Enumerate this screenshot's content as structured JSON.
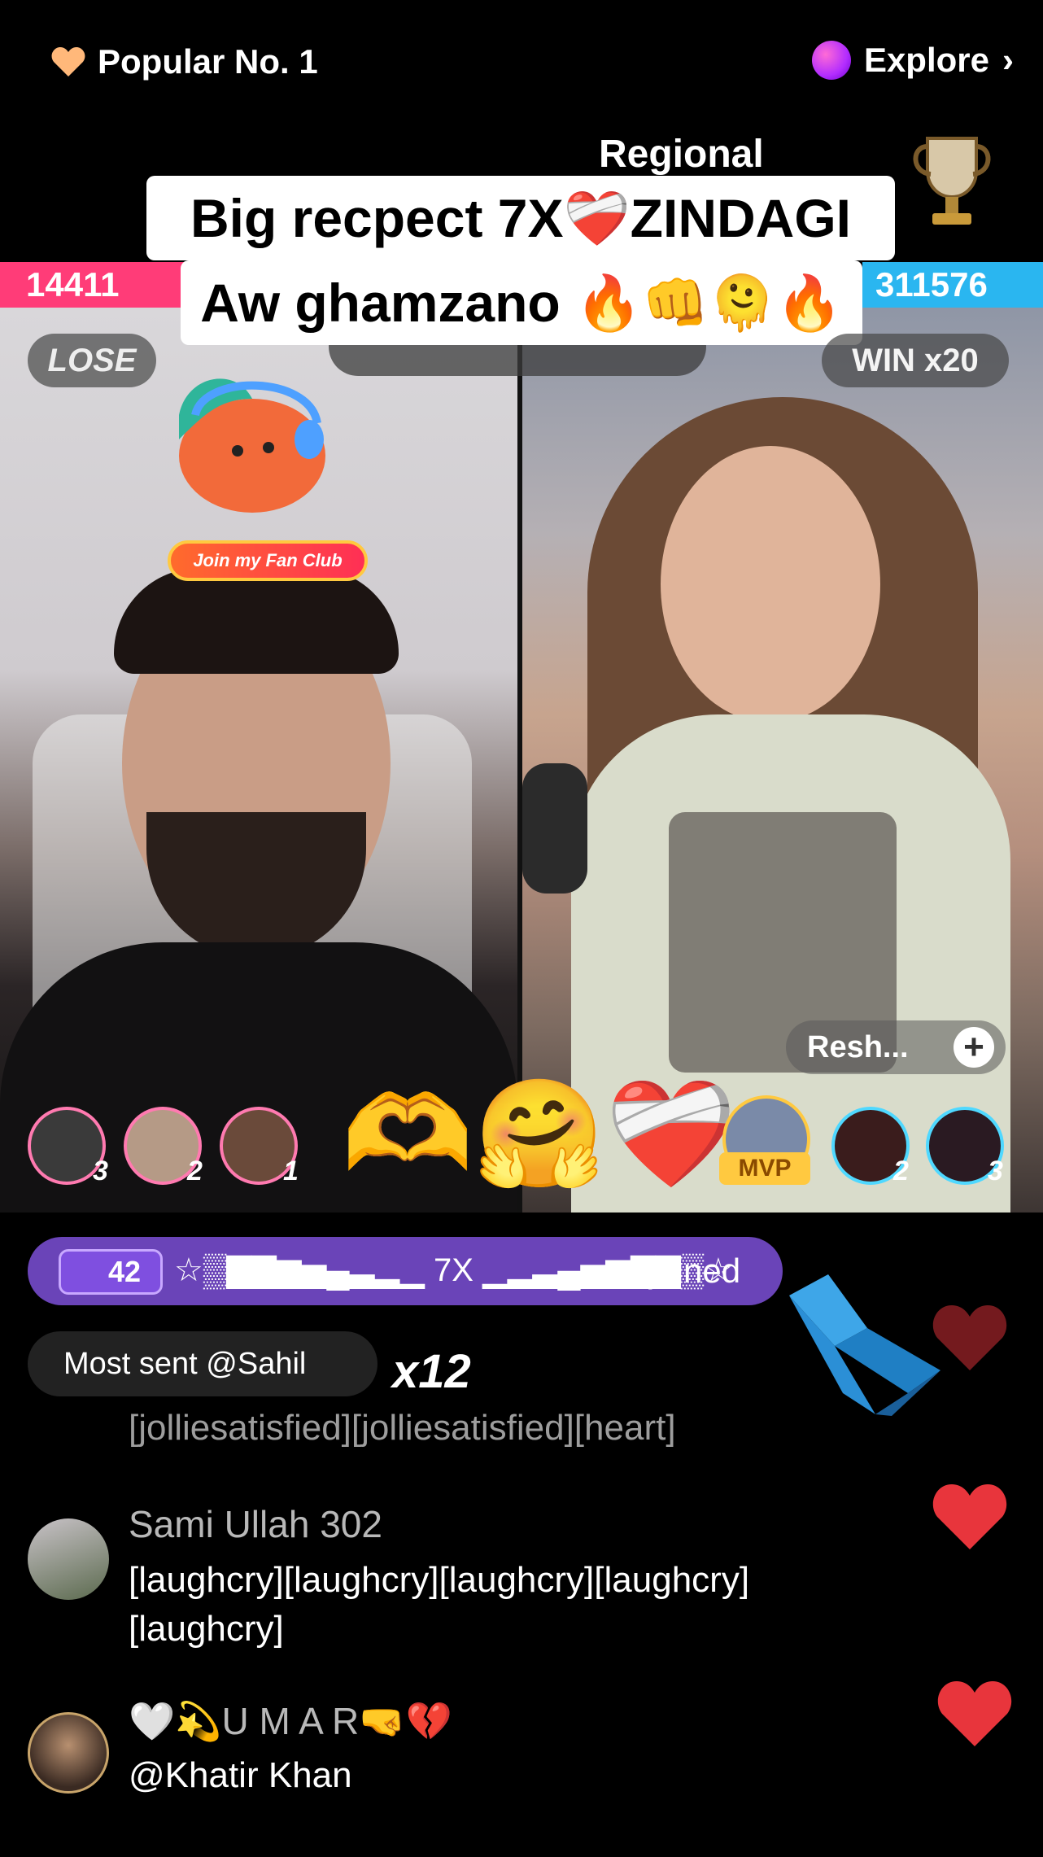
{
  "top": {
    "popular_label": "Popular No. 1",
    "explore_label": "Explore"
  },
  "regional_label": "Regional",
  "caption": {
    "line1": "Big recpect 7X❤️‍🩹ZINDAGI",
    "line2": "Aw ghamzano 🔥👊🫠🔥"
  },
  "battle": {
    "left_score": "14411",
    "right_score": "311576",
    "left_status": "LOSE",
    "right_status": "WIN x20",
    "fan_club_label": "Join my Fan Club",
    "right_guest_label": "Resh...",
    "left_gifter_ranks": [
      "3",
      "2",
      "1"
    ],
    "right_gifter_ranks": [
      "2",
      "3"
    ],
    "mvp_label": "MVP",
    "center_emojis": "🫶🤗❤️‍🩹"
  },
  "join_bar": {
    "level": "42",
    "name_text": "☆▒▇▇▆▅▄▃▂▁ 7X ▁▂▃▄▅▆▇▇▒☆",
    "joined_label": "joined"
  },
  "most_sent": {
    "label": "Most sent @Sahil",
    "multiplier": "x12"
  },
  "comments": [
    {
      "username": "",
      "message": "[jolliesatisfied][jolliesatisfied][heart]"
    },
    {
      "username": "Sami Ullah 302",
      "message_line1": "[laughcry][laughcry][laughcry][laughcry]",
      "message_line2": "[laughcry]"
    },
    {
      "username": "🤍💫U M A R🤜💔",
      "message": "@Khatir Khan"
    }
  ],
  "colors": {
    "left_team": "#ff3c78",
    "right_team": "#2ab6f0",
    "join_bar": "#6a44b8",
    "like_heart": "#e8353c"
  },
  "icons": [
    "heart-icon",
    "planet-icon",
    "chevron-right-icon",
    "trophy-icon",
    "plus-icon",
    "cursor-arrow-icon",
    "like-heart-icon"
  ]
}
